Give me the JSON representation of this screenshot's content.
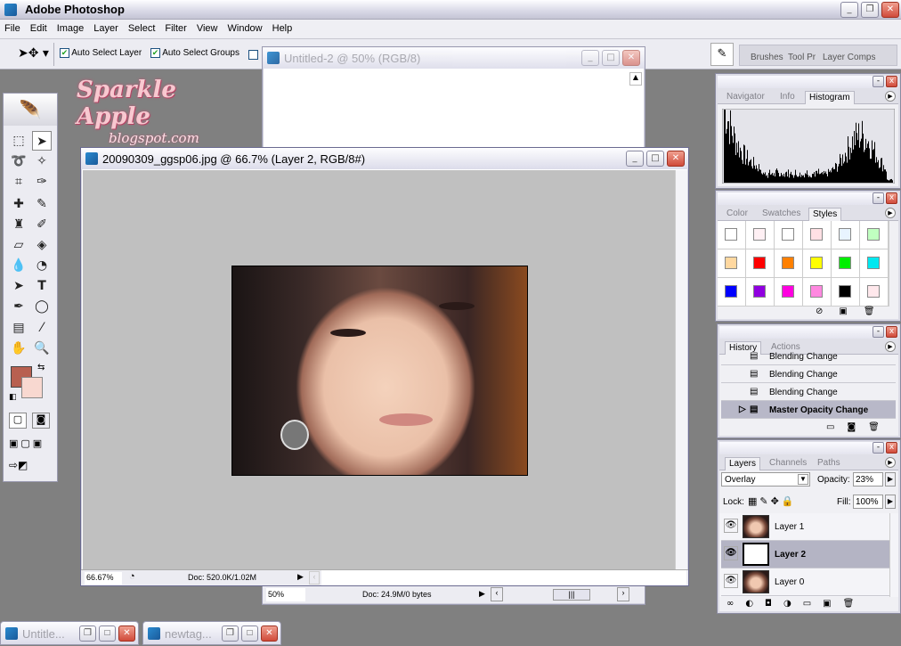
{
  "app": {
    "title": "Adobe Photoshop"
  },
  "menu": [
    "File",
    "Edit",
    "Image",
    "Layer",
    "Select",
    "Filter",
    "View",
    "Window",
    "Help"
  ],
  "options": {
    "auto_select_layer": "Auto Select Layer",
    "auto_select_groups": "Auto Select Groups",
    "auto_select_layer_checked": true,
    "auto_select_groups_checked": true
  },
  "palette_well": {
    "tabs": [
      "Brushes",
      "Tool Pr",
      "Layer Comps"
    ]
  },
  "logo": {
    "line1": "Sparkle Apple",
    "line2": "blogspot.com"
  },
  "doc_back": {
    "title": "Untitled-2 @ 50% (RGB/8)",
    "zoom": "50%",
    "doc_info": "Doc: 24.9M/0 bytes"
  },
  "doc_main": {
    "title": "20090309_ggsp06.jpg @ 66.7% (Layer 2, RGB/8#)",
    "zoom": "66.67%",
    "doc_info": "Doc: 520.0K/1.02M"
  },
  "toolbox": {
    "foreground": "#b86050",
    "background": "#f8d8d0"
  },
  "navigator_panel": {
    "tabs": [
      "Navigator",
      "Info",
      "Histogram"
    ],
    "active": "Histogram"
  },
  "color_panel": {
    "tabs": [
      "Color",
      "Swatches",
      "Styles"
    ],
    "active": "Styles",
    "styles": [
      "#ffffff",
      "#fff0f4",
      "#ffffff",
      "#ffe0e4",
      "#e8f4ff",
      "#c0ffc0",
      "#ffd8a0",
      "#ff0000",
      "#ff8000",
      "#ffff00",
      "#00ee00",
      "#00e8f0",
      "#0000ff",
      "#9000e0",
      "#ff00e0",
      "#ff88e0",
      "#000000",
      "#ffe8ec"
    ]
  },
  "history_panel": {
    "tabs": [
      "History",
      "Actions"
    ],
    "active": "History",
    "items": [
      "Blending Change",
      "Blending Change",
      "Blending Change",
      "Master Opacity Change"
    ]
  },
  "layers_panel": {
    "tabs": [
      "Layers",
      "Channels",
      "Paths"
    ],
    "active": "Layers",
    "blend_mode": "Overlay",
    "opacity_label": "Opacity:",
    "opacity": "23%",
    "lock_label": "Lock:",
    "fill_label": "Fill:",
    "fill": "100%",
    "layers": [
      {
        "name": "Layer 1",
        "selected": false
      },
      {
        "name": "Layer 2",
        "selected": true
      },
      {
        "name": "Layer 0",
        "selected": false
      }
    ]
  },
  "minimized": [
    "Untitle...",
    "newtag..."
  ]
}
